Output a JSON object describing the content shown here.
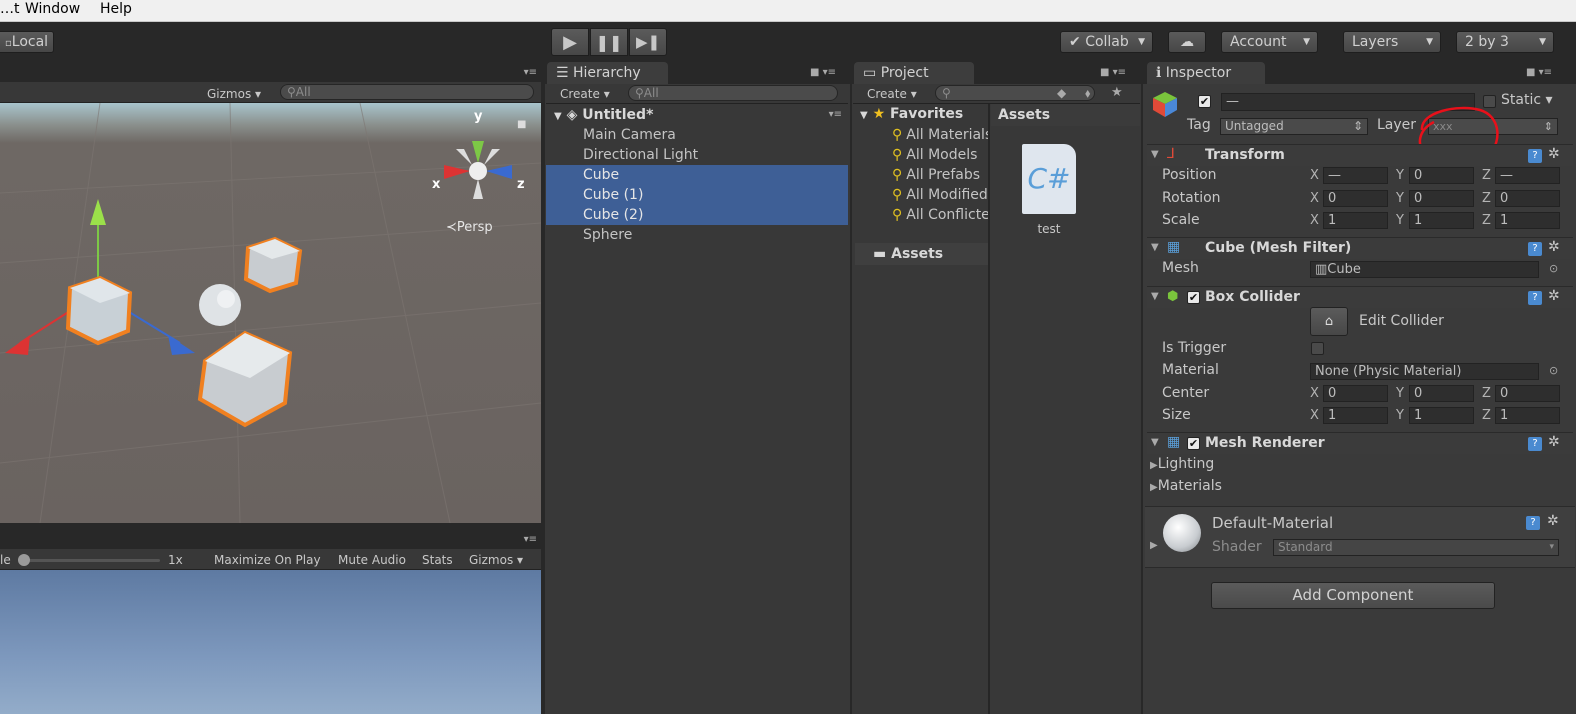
{
  "menu": {
    "items": [
      "…t",
      "Window",
      "Help"
    ]
  },
  "toolbar": {
    "local_label": "Local",
    "collab_label": "Collab",
    "account_label": "Account",
    "layers_label": "Layers",
    "layout_label": "2 by 3"
  },
  "scene": {
    "gizmos_label": "Gizmos",
    "search_placeholder": "All",
    "persp_label": "Persp",
    "axis_x": "x",
    "axis_y": "y",
    "axis_z": "z"
  },
  "game": {
    "scale_label": "le",
    "scale_value": "1x",
    "maximize_label": "Maximize On Play",
    "mute_label": "Mute Audio",
    "stats_label": "Stats",
    "gizmos_label": "Gizmos"
  },
  "hierarchy": {
    "tab_label": "Hierarchy",
    "create_label": "Create",
    "search_placeholder": "All",
    "scene_name": "Untitled*",
    "items": [
      {
        "label": "Main Camera",
        "selected": false
      },
      {
        "label": "Directional Light",
        "selected": false
      },
      {
        "label": "Cube",
        "selected": true
      },
      {
        "label": "Cube (1)",
        "selected": true
      },
      {
        "label": "Cube (2)",
        "selected": true
      },
      {
        "label": "Sphere",
        "selected": false
      }
    ]
  },
  "project": {
    "tab_label": "Project",
    "create_label": "Create",
    "favorites_label": "Favorites",
    "favorites": [
      "All Materials",
      "All Models",
      "All Prefabs",
      "All Modified",
      "All Conflicted"
    ],
    "assets_folder": "Assets",
    "assets_header": "Assets",
    "asset_file": "test",
    "asset_icon_text": "C#"
  },
  "inspector": {
    "tab_label": "Inspector",
    "name_value": "—",
    "static_label": "Static",
    "tag_label": "Tag",
    "tag_value": "Untagged",
    "layer_label": "Layer",
    "layer_value": "xxx",
    "transform": {
      "title": "Transform",
      "position_label": "Position",
      "rotation_label": "Rotation",
      "scale_label": "Scale",
      "position": [
        "—",
        "0",
        "—"
      ],
      "rotation": [
        "0",
        "0",
        "0"
      ],
      "scale": [
        "1",
        "1",
        "1"
      ]
    },
    "mesh_filter": {
      "title": "Cube (Mesh Filter)",
      "mesh_label": "Mesh",
      "mesh_value": "Cube"
    },
    "box_collider": {
      "title": "Box Collider",
      "edit_label": "Edit Collider",
      "trigger_label": "Is Trigger",
      "material_label": "Material",
      "material_value": "None (Physic Material)",
      "center_label": "Center",
      "size_label": "Size",
      "center": [
        "0",
        "0",
        "0"
      ],
      "size": [
        "1",
        "1",
        "1"
      ]
    },
    "mesh_renderer": {
      "title": "Mesh Renderer",
      "lighting_label": "Lighting",
      "materials_label": "Materials"
    },
    "material": {
      "name": "Default-Material",
      "shader_label": "Shader",
      "shader_value": "Standard"
    },
    "add_component_label": "Add Component"
  },
  "colors": {
    "selection": "#3e5f96",
    "annotation": "#e8101a",
    "panel": "#383838"
  }
}
